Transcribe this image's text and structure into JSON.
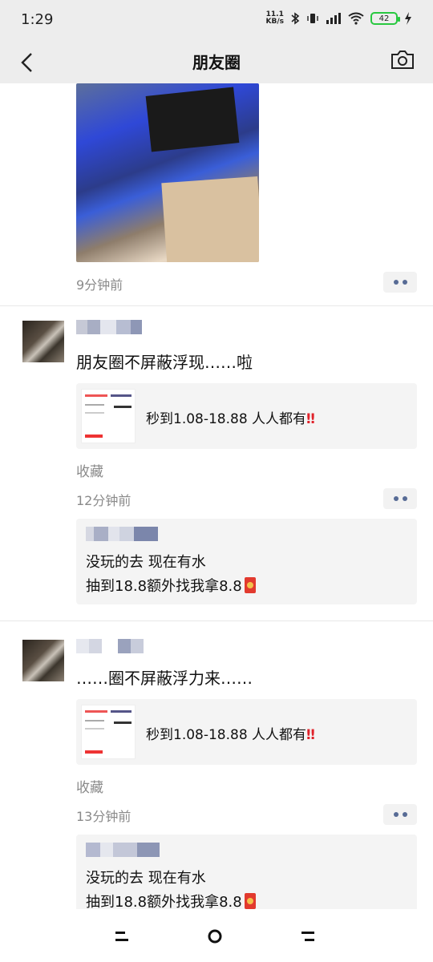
{
  "status": {
    "time": "1:29",
    "net_speed_top": "11.1",
    "net_speed_unit": "KB/s",
    "battery": "42"
  },
  "nav": {
    "title": "朋友圈"
  },
  "posts": [
    {
      "time": "9分钟前"
    },
    {
      "text": "朋友圈不屏蔽浮现……啦",
      "link_text": "秒到1.08-18.88 人人都有",
      "fav": "收藏",
      "time": "12分钟前",
      "comment_line1": "没玩的去 现在有水",
      "comment_line2": "抽到18.8额外找我拿8.8"
    },
    {
      "text": "……圈不屏蔽浮力来……",
      "link_text": "秒到1.08-18.88 人人都有",
      "fav": "收藏",
      "time": "13分钟前",
      "comment_line1": "没玩的去 现在有水",
      "comment_line2": "抽到18.8额外找我拿8.8"
    }
  ],
  "colors": {
    "accent_link": "#576b95",
    "battery": "#28c840",
    "exclaim": "#e0222a"
  }
}
